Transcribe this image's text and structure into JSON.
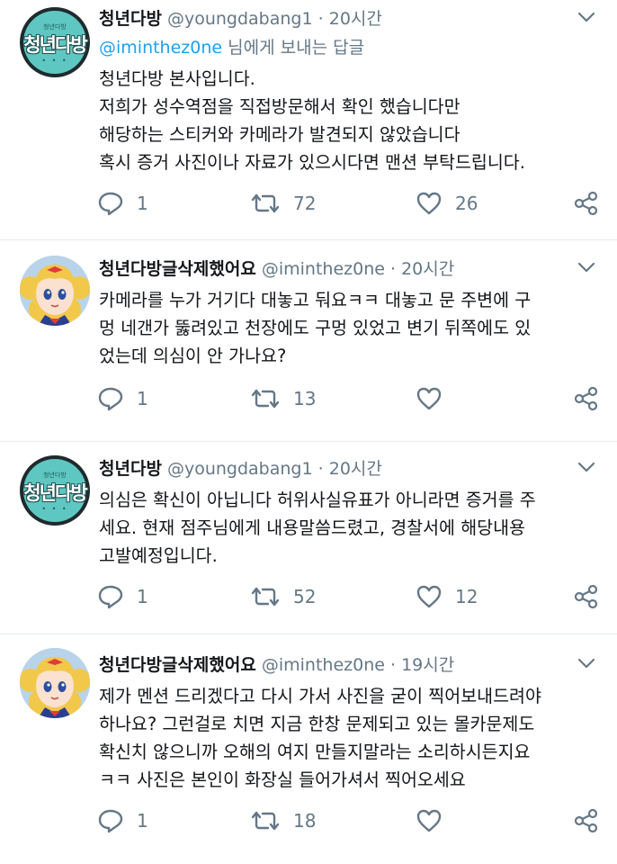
{
  "tweets": [
    {
      "display_name": "청년다방",
      "handle": "@youngdabang1",
      "time": "20시간",
      "reply_to_handle": "@iminthez0ne",
      "reply_to_suffix": "님에게 보내는 답글",
      "avatar_small": "청년다방",
      "avatar_big": "청년다방",
      "body": "청년다방 본사입니다.\n저희가 성수역점을 직접방문해서 확인 했습니다만\n해당하는 스티커와 카메라가 발견되지 않았습니다\n혹시 증거 사진이나 자료가 있으시다면 맨션 부탁드립니다.",
      "replies": "1",
      "retweets": "72",
      "likes": "26"
    },
    {
      "display_name": "청년다방글삭제했어요",
      "handle": "@iminthez0ne",
      "time": "20시간",
      "body": "카메라를 누가 거기다 대놓고 둬요ㅋㅋ 대놓고 문 주변에 구\n멍 네갠가 뚫려있고 천장에도 구멍 있었고 변기 뒤쪽에도 있\n었는데 의심이 안 가나요?",
      "replies": "1",
      "retweets": "13",
      "likes": ""
    },
    {
      "display_name": "청년다방",
      "handle": "@youngdabang1",
      "time": "20시간",
      "avatar_small": "청년다방",
      "avatar_big": "청년다방",
      "body": "의심은 확신이 아닙니다 허위사실유표가 아니라면 증거를 주\n세요. 현재 점주님에게 내용말씀드렸고, 경찰서에 해당내용\n고발예정입니다.",
      "replies": "1",
      "retweets": "52",
      "likes": "12"
    },
    {
      "display_name": "청년다방글삭제했어요",
      "handle": "@iminthez0ne",
      "time": "19시간",
      "body": "제가 멘션 드리겠다고 다시 가서 사진을 굳이 찍어보내드려야\n하나요? 그런걸로 치면 지금 한창 문제되고 있는 몰카문제도\n확신치 않으니까 오해의 여지 만들지말라는 소리하시든지요\nㅋㅋ 사진은 본인이 화장실 들어가셔서 찍어오세요",
      "replies": "1",
      "retweets": "18",
      "likes": ""
    }
  ],
  "separator": "·",
  "colors": {
    "text": "#14171a",
    "secondary": "#657786",
    "link": "#1da1f2",
    "divider": "#e6ecf0"
  },
  "icons": [
    "chevron-down-icon",
    "reply-icon",
    "retweet-icon",
    "like-icon",
    "share-icon",
    "sailor-moon-avatar",
    "cafe-logo-avatar"
  ]
}
